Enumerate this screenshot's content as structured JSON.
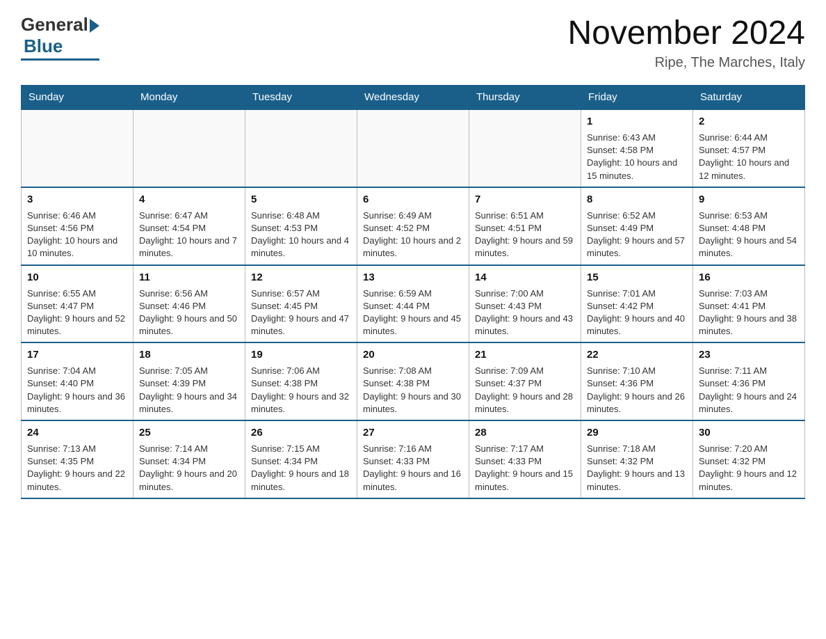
{
  "header": {
    "logo_general": "General",
    "logo_blue": "Blue",
    "title": "November 2024",
    "subtitle": "Ripe, The Marches, Italy"
  },
  "weekdays": [
    "Sunday",
    "Monday",
    "Tuesday",
    "Wednesday",
    "Thursday",
    "Friday",
    "Saturday"
  ],
  "weeks": [
    [
      {
        "day": "",
        "data": ""
      },
      {
        "day": "",
        "data": ""
      },
      {
        "day": "",
        "data": ""
      },
      {
        "day": "",
        "data": ""
      },
      {
        "day": "",
        "data": ""
      },
      {
        "day": "1",
        "data": "Sunrise: 6:43 AM\nSunset: 4:58 PM\nDaylight: 10 hours and 15 minutes."
      },
      {
        "day": "2",
        "data": "Sunrise: 6:44 AM\nSunset: 4:57 PM\nDaylight: 10 hours and 12 minutes."
      }
    ],
    [
      {
        "day": "3",
        "data": "Sunrise: 6:46 AM\nSunset: 4:56 PM\nDaylight: 10 hours and 10 minutes."
      },
      {
        "day": "4",
        "data": "Sunrise: 6:47 AM\nSunset: 4:54 PM\nDaylight: 10 hours and 7 minutes."
      },
      {
        "day": "5",
        "data": "Sunrise: 6:48 AM\nSunset: 4:53 PM\nDaylight: 10 hours and 4 minutes."
      },
      {
        "day": "6",
        "data": "Sunrise: 6:49 AM\nSunset: 4:52 PM\nDaylight: 10 hours and 2 minutes."
      },
      {
        "day": "7",
        "data": "Sunrise: 6:51 AM\nSunset: 4:51 PM\nDaylight: 9 hours and 59 minutes."
      },
      {
        "day": "8",
        "data": "Sunrise: 6:52 AM\nSunset: 4:49 PM\nDaylight: 9 hours and 57 minutes."
      },
      {
        "day": "9",
        "data": "Sunrise: 6:53 AM\nSunset: 4:48 PM\nDaylight: 9 hours and 54 minutes."
      }
    ],
    [
      {
        "day": "10",
        "data": "Sunrise: 6:55 AM\nSunset: 4:47 PM\nDaylight: 9 hours and 52 minutes."
      },
      {
        "day": "11",
        "data": "Sunrise: 6:56 AM\nSunset: 4:46 PM\nDaylight: 9 hours and 50 minutes."
      },
      {
        "day": "12",
        "data": "Sunrise: 6:57 AM\nSunset: 4:45 PM\nDaylight: 9 hours and 47 minutes."
      },
      {
        "day": "13",
        "data": "Sunrise: 6:59 AM\nSunset: 4:44 PM\nDaylight: 9 hours and 45 minutes."
      },
      {
        "day": "14",
        "data": "Sunrise: 7:00 AM\nSunset: 4:43 PM\nDaylight: 9 hours and 43 minutes."
      },
      {
        "day": "15",
        "data": "Sunrise: 7:01 AM\nSunset: 4:42 PM\nDaylight: 9 hours and 40 minutes."
      },
      {
        "day": "16",
        "data": "Sunrise: 7:03 AM\nSunset: 4:41 PM\nDaylight: 9 hours and 38 minutes."
      }
    ],
    [
      {
        "day": "17",
        "data": "Sunrise: 7:04 AM\nSunset: 4:40 PM\nDaylight: 9 hours and 36 minutes."
      },
      {
        "day": "18",
        "data": "Sunrise: 7:05 AM\nSunset: 4:39 PM\nDaylight: 9 hours and 34 minutes."
      },
      {
        "day": "19",
        "data": "Sunrise: 7:06 AM\nSunset: 4:38 PM\nDaylight: 9 hours and 32 minutes."
      },
      {
        "day": "20",
        "data": "Sunrise: 7:08 AM\nSunset: 4:38 PM\nDaylight: 9 hours and 30 minutes."
      },
      {
        "day": "21",
        "data": "Sunrise: 7:09 AM\nSunset: 4:37 PM\nDaylight: 9 hours and 28 minutes."
      },
      {
        "day": "22",
        "data": "Sunrise: 7:10 AM\nSunset: 4:36 PM\nDaylight: 9 hours and 26 minutes."
      },
      {
        "day": "23",
        "data": "Sunrise: 7:11 AM\nSunset: 4:36 PM\nDaylight: 9 hours and 24 minutes."
      }
    ],
    [
      {
        "day": "24",
        "data": "Sunrise: 7:13 AM\nSunset: 4:35 PM\nDaylight: 9 hours and 22 minutes."
      },
      {
        "day": "25",
        "data": "Sunrise: 7:14 AM\nSunset: 4:34 PM\nDaylight: 9 hours and 20 minutes."
      },
      {
        "day": "26",
        "data": "Sunrise: 7:15 AM\nSunset: 4:34 PM\nDaylight: 9 hours and 18 minutes."
      },
      {
        "day": "27",
        "data": "Sunrise: 7:16 AM\nSunset: 4:33 PM\nDaylight: 9 hours and 16 minutes."
      },
      {
        "day": "28",
        "data": "Sunrise: 7:17 AM\nSunset: 4:33 PM\nDaylight: 9 hours and 15 minutes."
      },
      {
        "day": "29",
        "data": "Sunrise: 7:18 AM\nSunset: 4:32 PM\nDaylight: 9 hours and 13 minutes."
      },
      {
        "day": "30",
        "data": "Sunrise: 7:20 AM\nSunset: 4:32 PM\nDaylight: 9 hours and 12 minutes."
      }
    ]
  ]
}
